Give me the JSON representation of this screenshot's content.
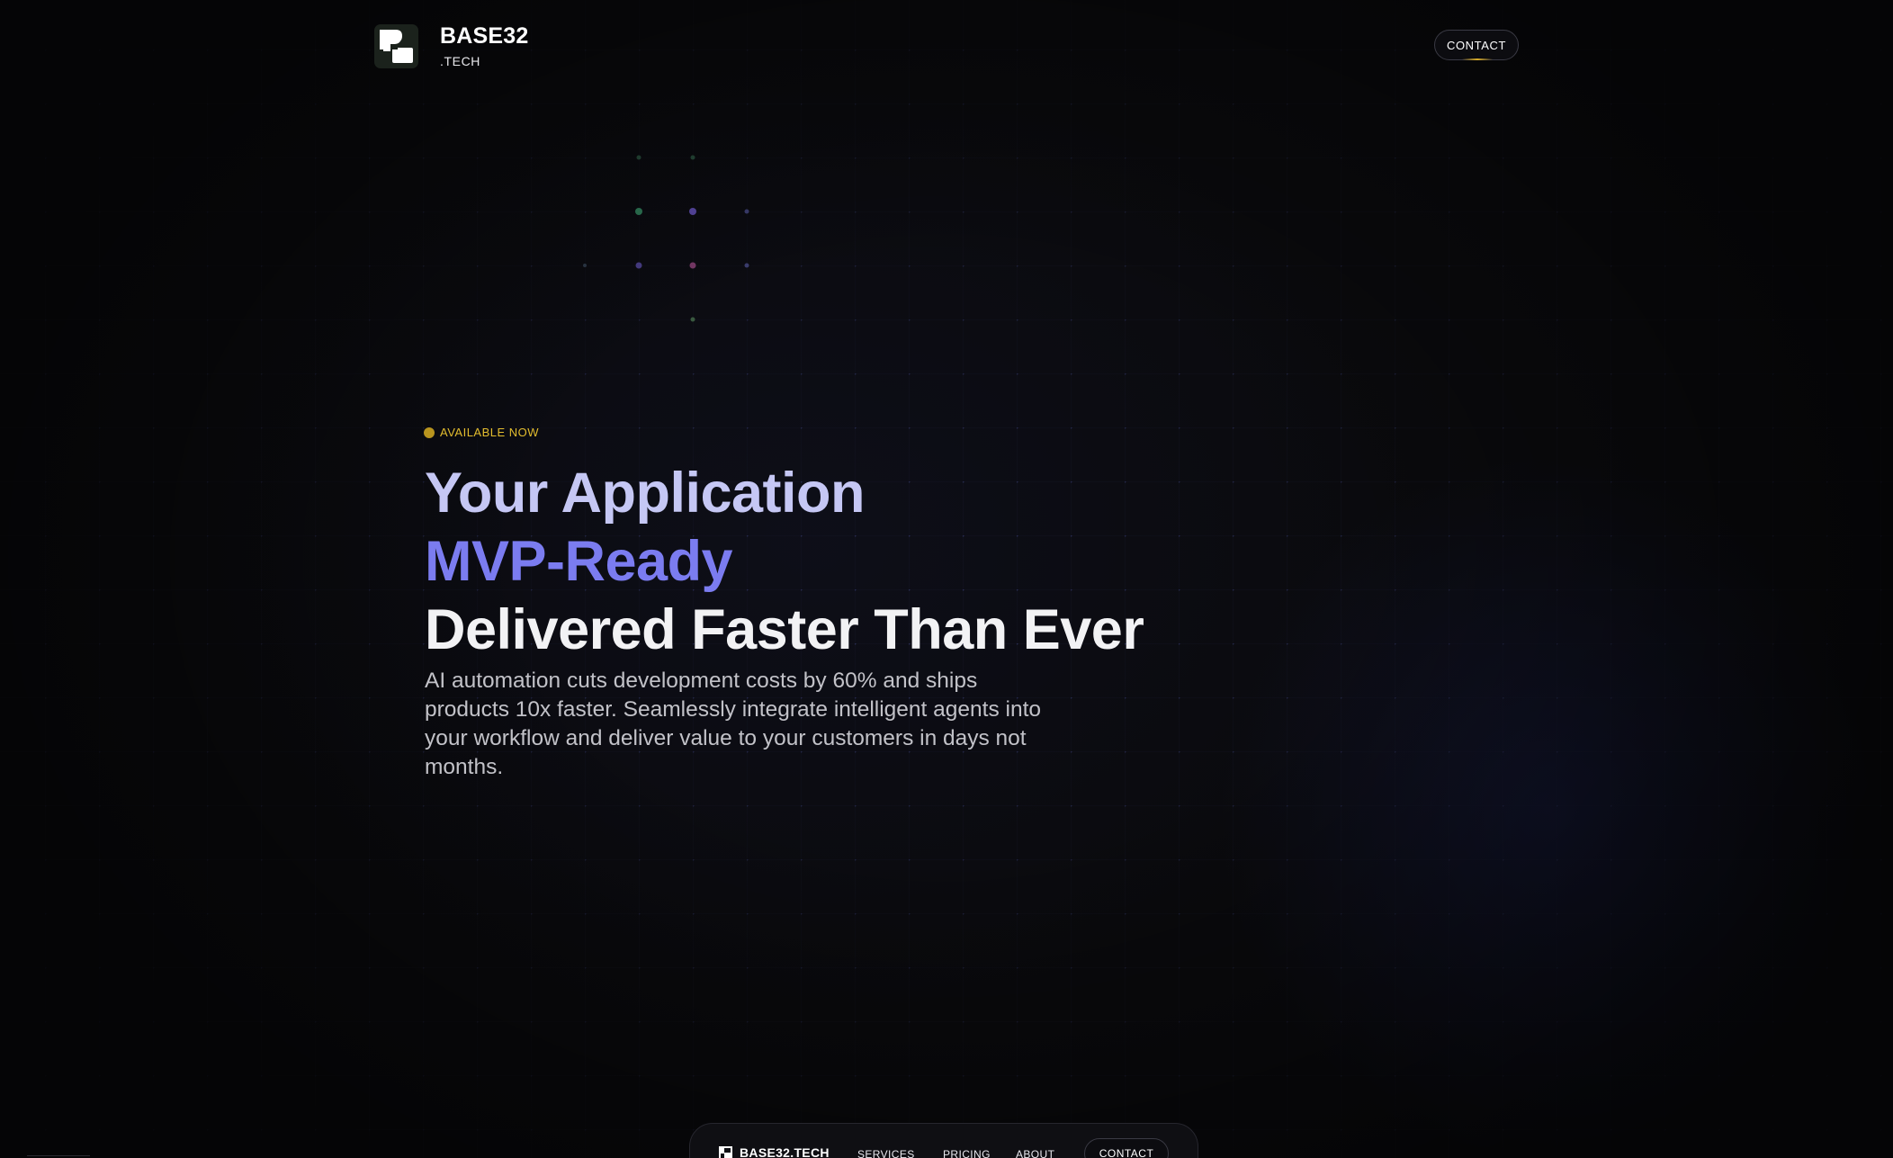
{
  "brand": {
    "name": "BASE32",
    "sub": ".TECH"
  },
  "header": {
    "contact_label": "CONTACT"
  },
  "hero": {
    "badge": "AVAILABLE NOW",
    "headline_line1": "Your Application",
    "headline_line2": "MVP-Ready",
    "headline_line3": "Delivered Faster Than Ever",
    "description": "AI automation cuts development costs by 60% and ships products 10x faster. Seamlessly integrate intelligent agents into your workflow and deliver value to your customers in days not months."
  },
  "bottom_nav": {
    "brand": "BASE32.TECH",
    "links": [
      "SERVICES",
      "PRICING",
      "ABOUT"
    ],
    "contact_label": "CONTACT"
  },
  "colors": {
    "accent_yellow": "#e3bd2e",
    "headline_lavender": "#c5c7f4",
    "headline_indigo": "#7b7cf0",
    "headline_white": "#f2f2f4",
    "background": "#0a0a0d"
  },
  "icons": {
    "logo": "base32-logo-icon",
    "badge": "status-dot-icon"
  }
}
